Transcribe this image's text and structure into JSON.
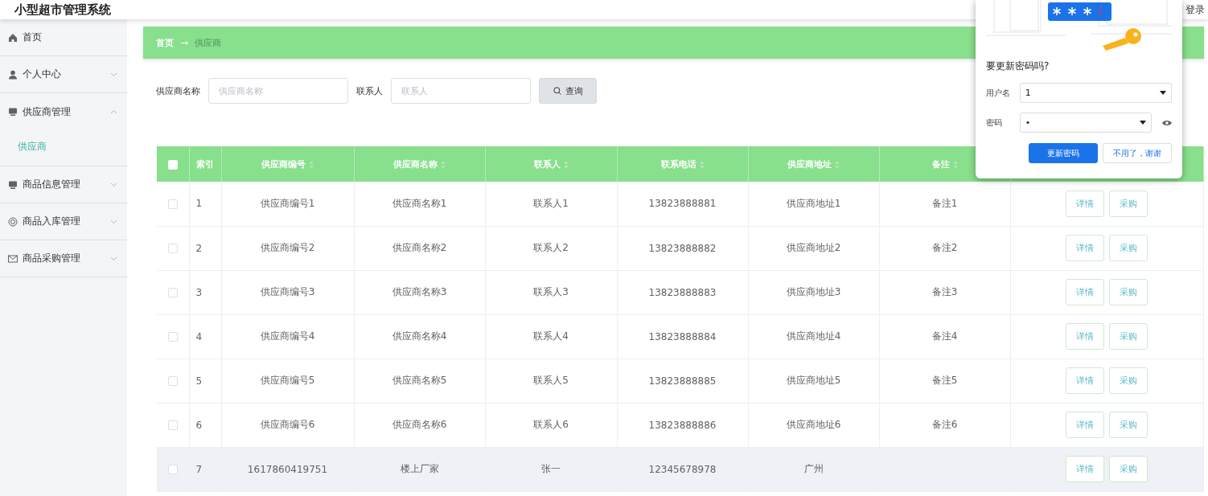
{
  "app": {
    "title": "小型超市管理系统",
    "login": "登录"
  },
  "sidebar": {
    "items": [
      {
        "label": "首页",
        "kind": "link"
      },
      {
        "label": "个人中心",
        "kind": "group",
        "expanded": false
      },
      {
        "label": "供应商管理",
        "kind": "group",
        "expanded": true,
        "children": [
          {
            "label": "供应商",
            "selected": true
          }
        ]
      },
      {
        "label": "商品信息管理",
        "kind": "group",
        "expanded": false
      },
      {
        "label": "商品入库管理",
        "kind": "group",
        "expanded": false
      },
      {
        "label": "商品采购管理",
        "kind": "group",
        "expanded": false
      }
    ]
  },
  "breadcrumb": {
    "items": [
      "首页",
      "供应商"
    ],
    "separator": "→"
  },
  "search": {
    "fields": [
      {
        "label": "供应商名称",
        "placeholder": "供应商名称"
      },
      {
        "label": "联系人",
        "placeholder": "联系人"
      }
    ],
    "button": "查询"
  },
  "table": {
    "select_all_checked": false,
    "columns": [
      {
        "label": "索引",
        "sortable": false
      },
      {
        "label": "供应商编号",
        "sortable": true
      },
      {
        "label": "供应商名称",
        "sortable": true
      },
      {
        "label": "联系人",
        "sortable": true
      },
      {
        "label": "联系电话",
        "sortable": true
      },
      {
        "label": "供应商地址",
        "sortable": true
      },
      {
        "label": "备注",
        "sortable": true
      }
    ],
    "rows": [
      {
        "checked": false,
        "highlighted": false,
        "cells": [
          "1",
          "供应商编号1",
          "供应商名称1",
          "联系人1",
          "13823888881",
          "供应商地址1",
          "备注1"
        ],
        "actions": [
          "详情",
          "采购"
        ]
      },
      {
        "checked": false,
        "highlighted": false,
        "cells": [
          "2",
          "供应商编号2",
          "供应商名称2",
          "联系人2",
          "13823888882",
          "供应商地址2",
          "备注2"
        ],
        "actions": [
          "详情",
          "采购"
        ]
      },
      {
        "checked": false,
        "highlighted": false,
        "cells": [
          "3",
          "供应商编号3",
          "供应商名称3",
          "联系人3",
          "13823888883",
          "供应商地址3",
          "备注3"
        ],
        "actions": [
          "详情",
          "采购"
        ]
      },
      {
        "checked": false,
        "highlighted": false,
        "cells": [
          "4",
          "供应商编号4",
          "供应商名称4",
          "联系人4",
          "13823888884",
          "供应商地址4",
          "备注4"
        ],
        "actions": [
          "详情",
          "采购"
        ]
      },
      {
        "checked": false,
        "highlighted": false,
        "cells": [
          "5",
          "供应商编号5",
          "供应商名称5",
          "联系人5",
          "13823888885",
          "供应商地址5",
          "备注5"
        ],
        "actions": [
          "详情",
          "采购"
        ]
      },
      {
        "checked": false,
        "highlighted": false,
        "cells": [
          "6",
          "供应商编号6",
          "供应商名称6",
          "联系人6",
          "13823888886",
          "供应商地址6",
          "备注6"
        ],
        "actions": [
          "详情",
          "采购"
        ]
      },
      {
        "checked": false,
        "highlighted": true,
        "cells": [
          "7",
          "1617860419751",
          "楼上厂家",
          "张一",
          "12345678978",
          "广州",
          ""
        ],
        "actions": [
          "详情",
          "采购"
        ]
      }
    ]
  },
  "password_popup": {
    "title": "要更新密码吗?",
    "fields": [
      {
        "label": "用户名",
        "value": "1",
        "reveal": false
      },
      {
        "label": "密码",
        "value": "•",
        "reveal": true
      }
    ],
    "buttons": [
      {
        "label": "更新密码",
        "primary": true
      },
      {
        "label": "不用了，谢谢",
        "primary": false
      }
    ]
  }
}
